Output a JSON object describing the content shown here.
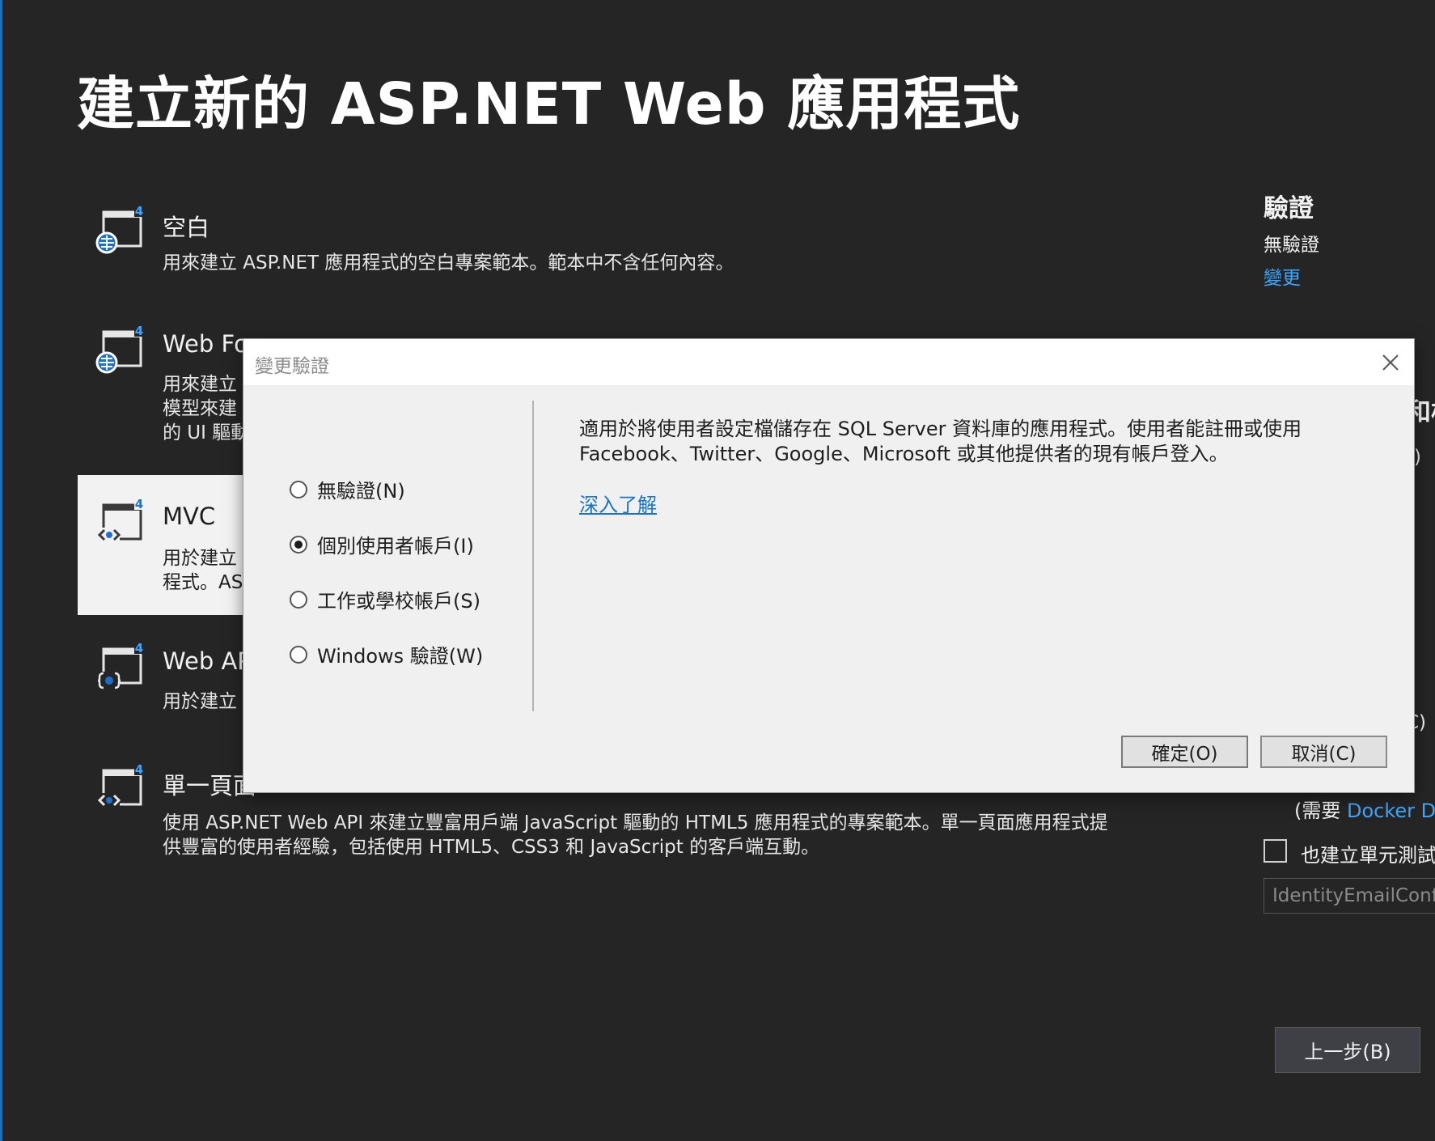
{
  "page_title": "建立新的 ASP.NET Web 應用程式",
  "templates": [
    {
      "name": "空白",
      "desc": [
        "用來建立 ASP.NET 應用程式的空白專案範本。範本中不含任何內容。"
      ]
    },
    {
      "name": "Web Fo",
      "desc": [
        "用來建立",
        "模型來建",
        "的 UI 驅動"
      ]
    },
    {
      "name": "MVC",
      "desc": [
        "用於建立",
        "程式。AS"
      ]
    },
    {
      "name": "Web AP",
      "desc": [
        "用於建立"
      ]
    },
    {
      "name": "單一頁面",
      "desc": [
        "使用 ASP.NET Web API 來建立豐富用戶端 JavaScript 驅動的 HTML5 應用程式的專案範本。單一頁面應用程式提",
        "供豐富的使用者經驗，包括使用 HTML5、CSS3 和 JavaScript 的客戶端互動。"
      ]
    }
  ],
  "auth_panel": {
    "heading": "驗證",
    "value": "無驗證",
    "change_link": "變更"
  },
  "right_peek": {
    "core_fragment": "和核",
    "paren_fragment_1": ")",
    "paren_fragment_2": "C)"
  },
  "docker": {
    "prefix": "(需要",
    "link": "Docker De"
  },
  "unit_test_label": "也建立單元測試",
  "unit_test_name_value": "IdentityEmailConf",
  "back_button": "上一步(B)",
  "dialog": {
    "title": "變更驗證",
    "options": [
      {
        "label": "無驗證(N)",
        "selected": false
      },
      {
        "label": "個別使用者帳戶(I)",
        "selected": true
      },
      {
        "label": "工作或學校帳戶(S)",
        "selected": false
      },
      {
        "label": "Windows 驗證(W)",
        "selected": false
      }
    ],
    "description": [
      "適用於將使用者設定檔儲存在 SQL Server 資料庫的應用程式。使用者能註冊或使用",
      "Facebook、Twitter、Google、Microsoft 或其他提供者的現有帳戶登入。"
    ],
    "learn_more": "深入了解",
    "ok_button": "確定(O)",
    "cancel_button": "取消(C)"
  }
}
